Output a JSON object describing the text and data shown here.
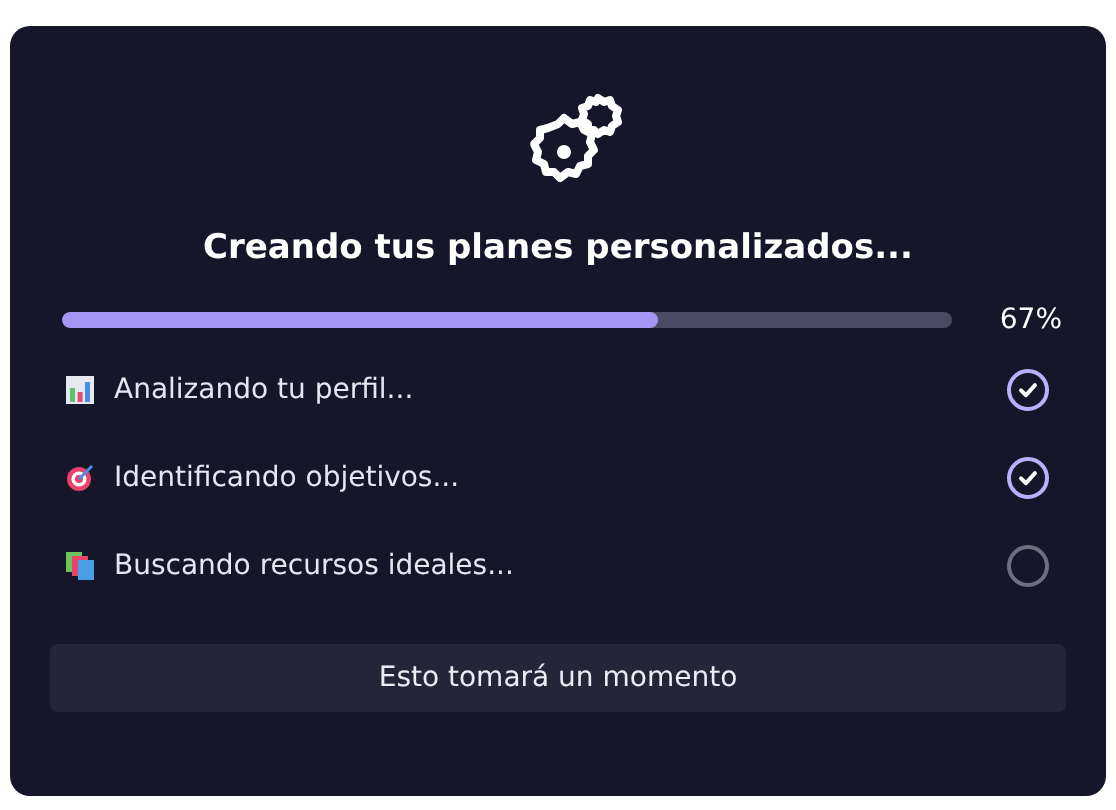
{
  "title": "Creando tus planes personalizados...",
  "progress": {
    "level": 0.67,
    "reading": "67%"
  },
  "steps": [
    {
      "label": "Analizando tu perfil...",
      "done": true
    },
    {
      "label": "Identificando objetivos...",
      "done": true
    },
    {
      "label": "Buscando recursos ideales...",
      "done": false
    }
  ],
  "footer": "Esto tomará un momento"
}
